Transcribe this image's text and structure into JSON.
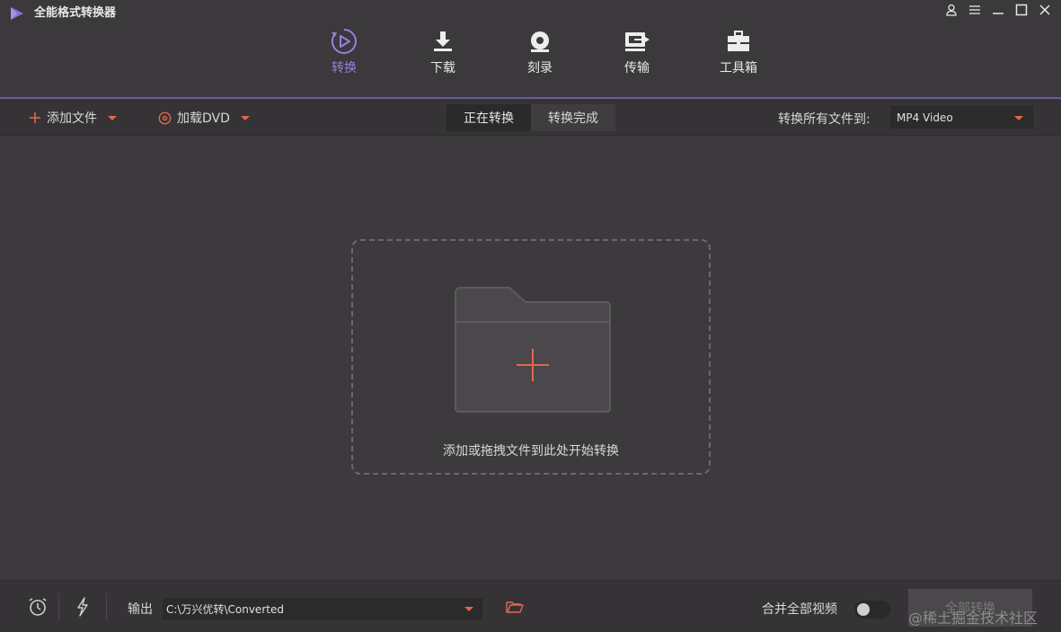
{
  "app": {
    "title": "全能格式转换器"
  },
  "window_controls": [
    "user-icon",
    "menu-icon",
    "minimize-icon",
    "maximize-icon",
    "close-icon"
  ],
  "nav": {
    "items": [
      {
        "label": "转换",
        "icon": "convert-icon",
        "active": true
      },
      {
        "label": "下载",
        "icon": "download-icon",
        "active": false
      },
      {
        "label": "刻录",
        "icon": "burn-icon",
        "active": false
      },
      {
        "label": "传输",
        "icon": "transfer-icon",
        "active": false
      },
      {
        "label": "工具箱",
        "icon": "toolbox-icon",
        "active": false
      }
    ]
  },
  "toolbar": {
    "add_file_label": "添加文件",
    "load_dvd_label": "加载DVD",
    "tabs": [
      "正在转换",
      "转换完成"
    ],
    "active_tab": "正在转换",
    "convert_all_to_label": "转换所有文件到:",
    "format_value": "MP4 Video"
  },
  "main": {
    "dropzone_text": "添加或拖拽文件到此处开始转换"
  },
  "bottom": {
    "output_label": "输出",
    "output_path": "C:\\万兴优转\\Converted",
    "merge_label": "合并全部视频",
    "merge_enabled": false,
    "convert_all_label": "全部转换",
    "watermark": "@稀土掘金技术社区"
  },
  "colors": {
    "accent_purple": "#8c6fd6",
    "accent_orange": "#e4674d",
    "background": "#3b393b"
  }
}
